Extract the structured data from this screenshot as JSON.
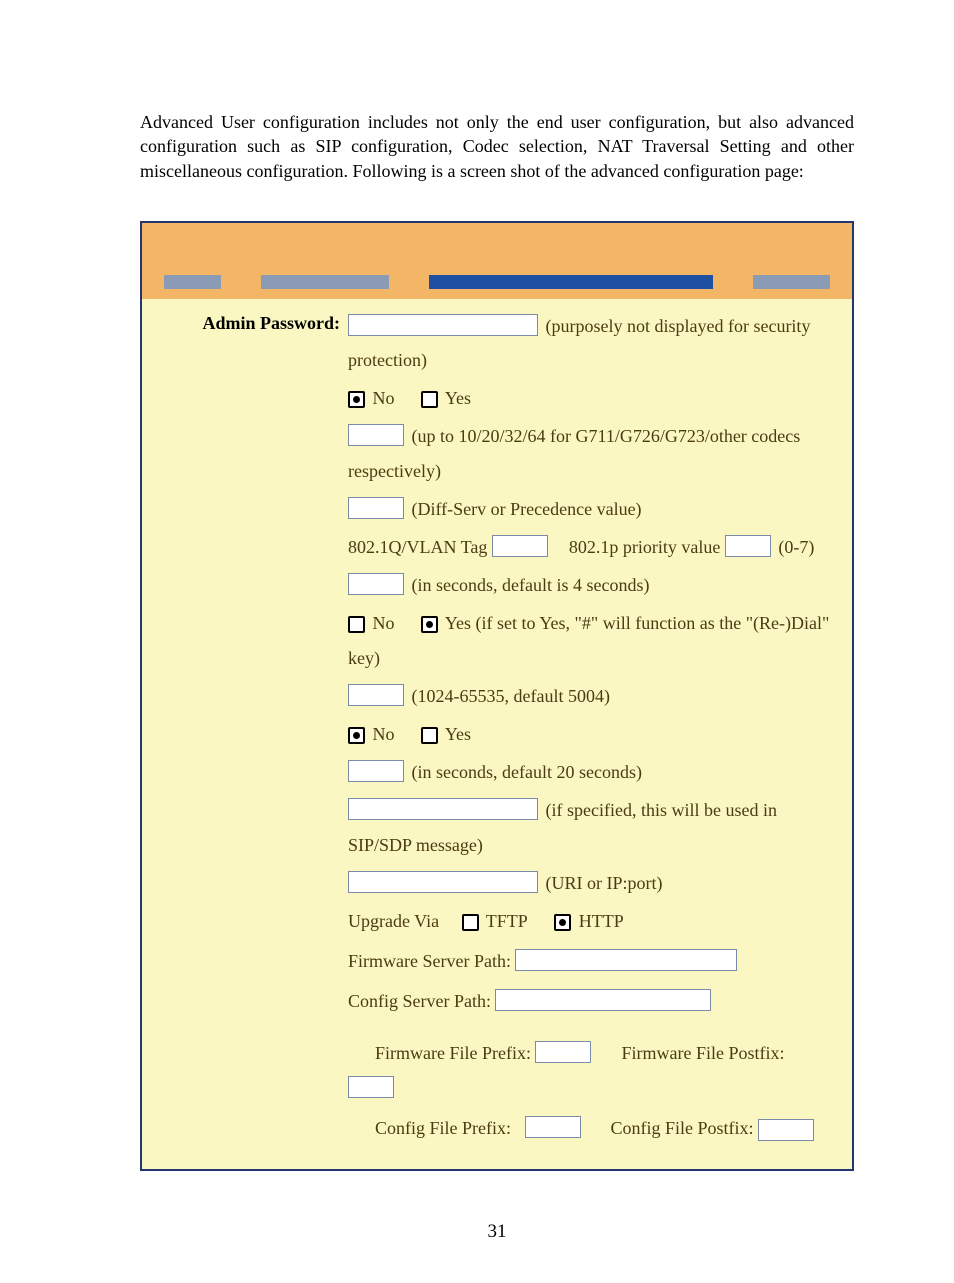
{
  "intro_text": "Advanced User configuration includes not only the end user configuration, but also advanced configuration such as SIP configuration, Codec selection, NAT Traversal Setting and other miscellaneous configuration.  Following is a screen shot of the advanced configuration page:",
  "rows": {
    "admin_password": {
      "label": "Admin Password:",
      "note": "(purposely not displayed for security protection)"
    },
    "radio_row1": {
      "no": "No",
      "yes": "Yes"
    },
    "frames_tx": {
      "note": "(up to 10/20/32/64 for G711/G726/G723/other codecs respectively)"
    },
    "diffserv": {
      "note": "(Diff-Serv or Precedence value)"
    },
    "vlan": {
      "a": "802.1Q/VLAN Tag",
      "b": "802.1p priority value",
      "c": "(0-7)"
    },
    "seconds4": {
      "note": "(in seconds, default is 4 seconds)"
    },
    "pound": {
      "no": "No",
      "yes_prefix": "Yes (if set to Yes, \"#\" will function as the \"(Re-)Dial\" key)"
    },
    "rtp_port": {
      "note": "(1024-65535, default 5004)"
    },
    "radio_row2": {
      "no": "No",
      "yes": "Yes"
    },
    "seconds20": {
      "note": "(in seconds, default 20 seconds)"
    },
    "sip_sdp": {
      "note": "(if specified, this will be used in SIP/SDP message)"
    },
    "uri": {
      "note": "(URI or IP:port)"
    },
    "upgrade": {
      "label": "Upgrade Via",
      "tftp": "TFTP",
      "http": "HTTP",
      "fw_server": "Firmware Server Path:",
      "cfg_server": "Config Server Path:",
      "fw_prefix": "Firmware File Prefix:",
      "fw_postfix": "Firmware File Postfix:",
      "cfg_prefix": "Config File Prefix:",
      "cfg_postfix": "Config File Postfix:"
    }
  },
  "page_number": "31"
}
